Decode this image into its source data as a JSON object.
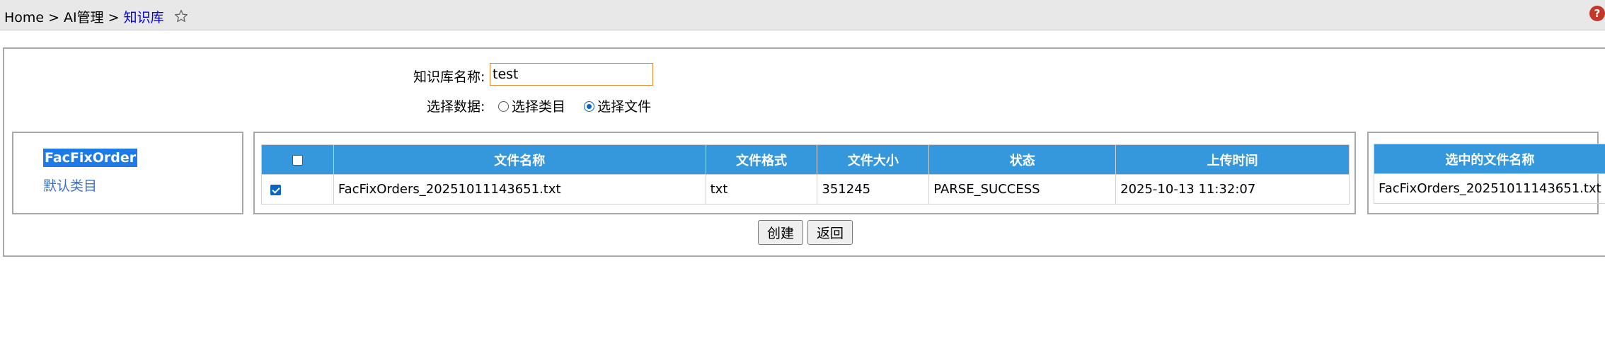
{
  "breadcrumb": {
    "home": "Home",
    "sep": ">",
    "parent": "AI管理",
    "current": "知识库"
  },
  "form": {
    "name_label": "知识库名称:",
    "name_value": "test",
    "data_label": "选择数据:",
    "radio_category": "选择类目",
    "radio_file": "选择文件"
  },
  "tree": {
    "items": [
      "FacFixOrder",
      "默认类目"
    ]
  },
  "file_table": {
    "headers": [
      "文件名称",
      "文件格式",
      "文件大小",
      "状态",
      "上传时间"
    ],
    "rows": [
      {
        "name": "FacFixOrders_20251011143651.txt",
        "format": "txt",
        "size": "351245",
        "status": "PARSE_SUCCESS",
        "time": "2025-10-13 11:32:07"
      }
    ]
  },
  "selected_table": {
    "header": "选中的文件名称",
    "rows": [
      "FacFixOrders_20251011143651.txt"
    ]
  },
  "buttons": {
    "create": "创建",
    "back": "返回"
  },
  "help": "?",
  "colors": {
    "header_bg": "#3598dc",
    "selected_bg": "#1e7ae6",
    "link": "#0000ee"
  }
}
